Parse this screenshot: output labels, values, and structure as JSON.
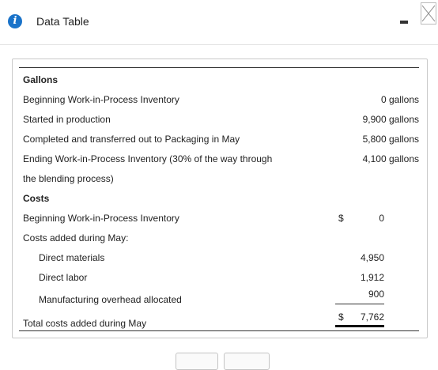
{
  "window": {
    "title": "Data Table",
    "icon": "info-icon",
    "accent_color": "#1a73c9"
  },
  "table": {
    "sections": {
      "gallons_header": "Gallons",
      "costs_header": "Costs"
    },
    "gallons": [
      {
        "label": "Beginning Work-in-Process Inventory",
        "value": "0 gallons"
      },
      {
        "label": "Started in production",
        "value": "9,900 gallons"
      },
      {
        "label": "Completed and transferred out to Packaging in May",
        "value": "5,800 gallons"
      },
      {
        "label": "Ending Work-in-Process Inventory (30% of the way through",
        "label_cont": "the blending process)",
        "value": "4,100 gallons"
      }
    ],
    "costs": {
      "beginning_wip": {
        "label": "Beginning Work-in-Process Inventory",
        "currency": "$",
        "value": "0"
      },
      "added_header": "Costs added during May:",
      "direct_materials": {
        "label": "Direct materials",
        "value": "4,950"
      },
      "direct_labor": {
        "label": "Direct labor",
        "value": "1,912"
      },
      "overhead": {
        "label": "Manufacturing overhead allocated",
        "value": "900"
      },
      "total": {
        "label": "Total costs added during May",
        "currency": "$",
        "value": "7,762"
      }
    }
  }
}
